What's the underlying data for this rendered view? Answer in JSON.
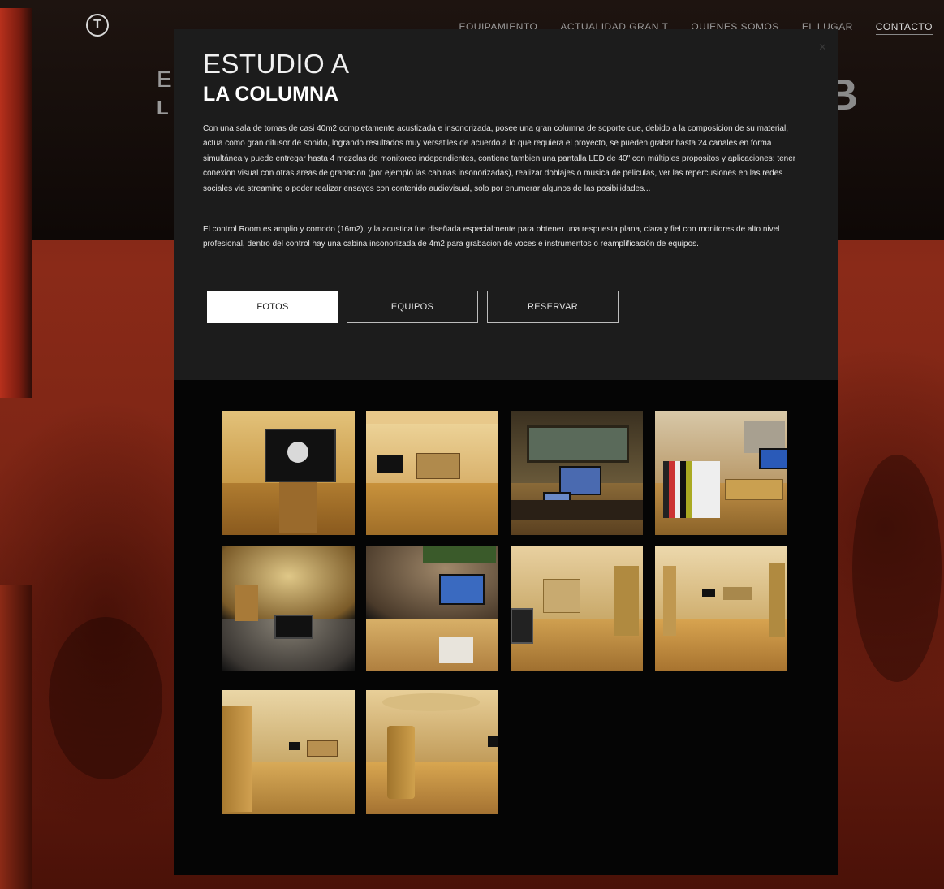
{
  "nav": {
    "logo_glyph": "T",
    "items": [
      "EQUIPAMIENTO",
      "ACTUALIDAD GRAN T",
      "QUIENES SOMOS",
      "EL LUGAR",
      "CONTACTO"
    ]
  },
  "background": {
    "heading_left_1": "E",
    "heading_left_2": "L",
    "heading_right": "B"
  },
  "modal": {
    "close_glyph": "×",
    "title": "ESTUDIO A",
    "subtitle": "LA COLUMNA",
    "paragraph_1": "Con una sala de tomas de casi 40m2 completamente acustizada e insonorizada, posee una gran columna de soporte que, debido a la composicion de su material, actua como gran difusor de sonido, logrando resultados muy versatiles de acuerdo a lo que requiera el proyecto, se pueden grabar hasta 24 canales en forma simultánea y puede entregar hasta 4 mezclas de monitoreo independientes, contiene tambien una pantalla LED de 40\" con múltiples propositos y aplicaciones: tener conexion visual con otras areas de grabacion (por ejemplo las cabinas insonorizadas), realizar doblajes o musica de peliculas, ver las repercusiones en las redes sociales via streaming o poder realizar ensayos con contenido audiovisual, solo por enumerar algunos de las posibilidades...",
    "paragraph_2": "El control Room es amplio y comodo (16m2), y la acustica fue diseñada especialmente para obtener una respuesta plana, clara y fiel con monitores de alto nivel profesional, dentro del control hay una cabina insonorizada de 4m2 para grabacion de voces e instrumentos o reamplificación de equipos.",
    "buttons": {
      "fotos": "FOTOS",
      "equipos": "EQUIPOS",
      "reservar": "RESERVAR"
    }
  },
  "colors": {
    "modal_top": "#1c1c1c",
    "modal_bottom": "#050505",
    "background_red": "#8a2a18",
    "photo_warm": "#c9a24a"
  }
}
